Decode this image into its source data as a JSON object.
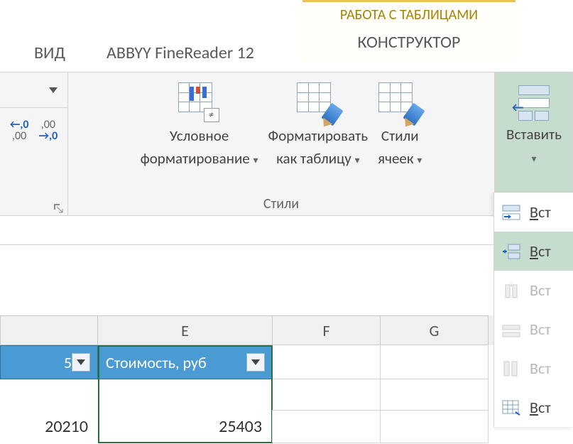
{
  "tabs": {
    "view": "ВИД",
    "abbyy": "ABBYY FineReader 12",
    "context_super": "РАБОТА С ТАБЛИЦАМИ",
    "context_tab": "КОНСТРУКТОР"
  },
  "ribbon": {
    "number": {
      "inc_decimal_top": "←,0",
      "inc_decimal_bot": ",00",
      "dec_decimal_top": ",00",
      "dec_decimal_bot": "→,0"
    },
    "styles": {
      "group_label": "Стили",
      "conditional_l1": "Условное",
      "conditional_l2": "форматирование",
      "format_table_l1": "Форматировать",
      "format_table_l2": "как таблицу",
      "cell_styles_l1": "Стили",
      "cell_styles_l2": "ячеек"
    },
    "cells": {
      "insert": "Вставить"
    }
  },
  "dropdown": {
    "item1": "Вст",
    "item2": "Вст",
    "item3": "Вст",
    "item4": "Вст",
    "item5": "Вст",
    "item6": "Вст"
  },
  "sheet": {
    "col_E": "E",
    "col_F": "F",
    "col_G": "G",
    "header_D_trunc": "5",
    "header_E": "Стоимость, руб",
    "val_D": "20210",
    "val_E": "25403"
  }
}
